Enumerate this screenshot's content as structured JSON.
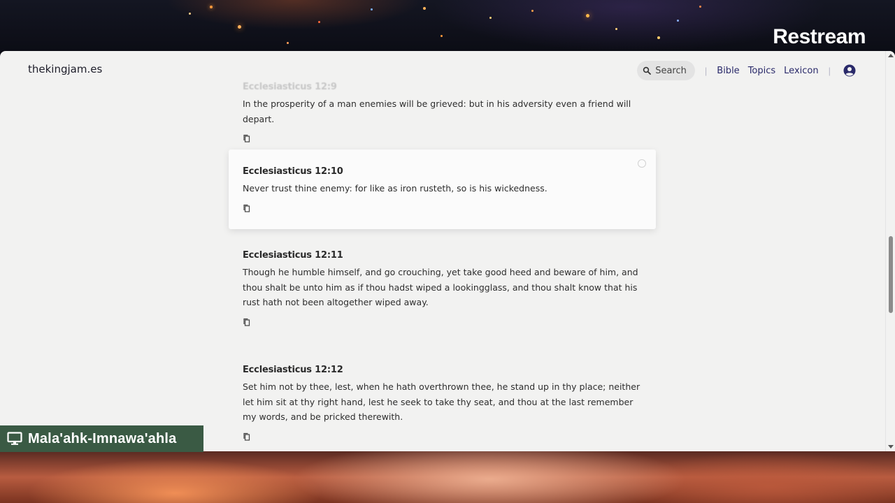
{
  "stream": {
    "logo_text": "Restream",
    "user_label": "Mala'ahk-Imnawa'ahla"
  },
  "site": {
    "brand": "thekingjam.es",
    "search_label": "Search",
    "nav_links": [
      "Bible",
      "Topics",
      "Lexicon"
    ]
  },
  "verses": [
    {
      "ref": "Ecclesiasticus 12:9",
      "text": "In the prosperity of a man enemies will be grieved: but in his adversity even a friend will depart."
    },
    {
      "ref": "Ecclesiasticus 12:10",
      "text": "Never trust thine enemy: for like as iron rusteth, so is his wickedness."
    },
    {
      "ref": "Ecclesiasticus 12:11",
      "text": "Though he humble himself, and go crouching, yet take good heed and beware of him, and thou shalt be unto him as if thou hadst wiped a lookingglass, and thou shalt know that his rust hath not been altogether wiped away."
    },
    {
      "ref": "Ecclesiasticus 12:12",
      "text": "Set him not by thee, lest, when he hath overthrown thee, he stand up in thy place; neither let him sit at thy right hand, lest he seek to take thy seat, and thou at the last remember my words, and be pricked therewith."
    }
  ],
  "icons": {
    "search": "search-icon",
    "account": "account-circle-icon",
    "copy": "copy-icon",
    "monitor": "monitor-icon"
  },
  "colors": {
    "page_bg": "#f2f2f1",
    "link": "#2a2a6a",
    "label_bg": "#3a5a44"
  }
}
